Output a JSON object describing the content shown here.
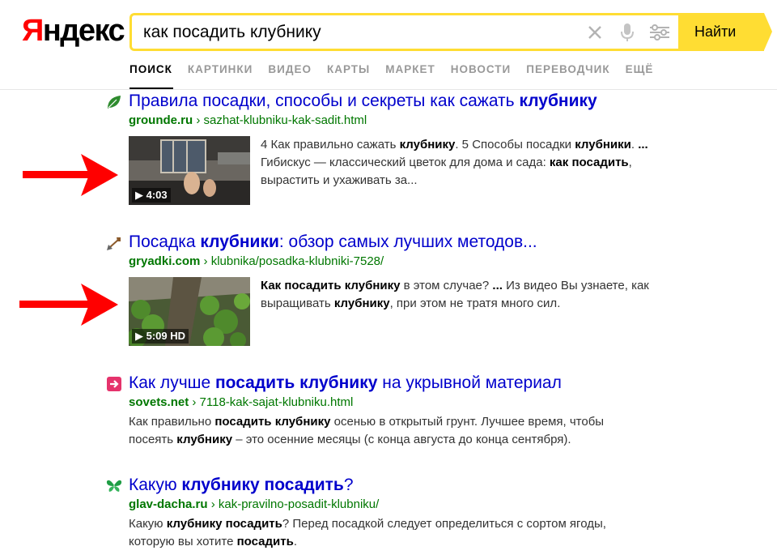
{
  "logo": {
    "first": "Я",
    "rest": "ндекс"
  },
  "search": {
    "query": "как посадить клубнику",
    "button": "Найти"
  },
  "tabs": [
    "ПОИСК",
    "КАРТИНКИ",
    "ВИДЕО",
    "КАРТЫ",
    "МАРКЕТ",
    "НОВОСТИ",
    "ПЕРЕВОДЧИК",
    "ЕЩЁ"
  ],
  "results": [
    {
      "title_parts": [
        {
          "t": "Правила посадки, способы и секреты как сажать ",
          "b": false
        },
        {
          "t": "клубнику",
          "b": true
        }
      ],
      "host": "grounde.ru",
      "path": "sazhat-klubniku-kak-sadit.html",
      "video_duration": "▶ 4:03",
      "snippet_parts": [
        {
          "t": "4 Как правильно сажать ",
          "b": false
        },
        {
          "t": "клубнику",
          "b": true
        },
        {
          "t": ". 5 Способы посадки ",
          "b": false
        },
        {
          "t": "клубники",
          "b": true
        },
        {
          "t": ". ",
          "b": false
        },
        {
          "t": "...",
          "b": true
        },
        {
          "t": " Гибискус — классический цветок для дома и сада: ",
          "b": false
        },
        {
          "t": "как посадить",
          "b": true
        },
        {
          "t": ", вырастить и ухаживать за...",
          "b": false
        }
      ]
    },
    {
      "title_parts": [
        {
          "t": "Посадка ",
          "b": false
        },
        {
          "t": "клубники",
          "b": true
        },
        {
          "t": ": обзор самых лучших методов...",
          "b": false
        }
      ],
      "host": "gryadki.com",
      "path": "klubnika/posadka-klubniki-7528/",
      "video_duration": "▶ 5:09 HD",
      "snippet_parts": [
        {
          "t": "Как посадить клубнику",
          "b": true
        },
        {
          "t": " в этом случае? ",
          "b": false
        },
        {
          "t": "...",
          "b": true
        },
        {
          "t": " Из видео Вы узнаете, как выращивать ",
          "b": false
        },
        {
          "t": "клубнику",
          "b": true
        },
        {
          "t": ", при этом не тратя много сил.",
          "b": false
        }
      ]
    },
    {
      "title_parts": [
        {
          "t": "Как лучше ",
          "b": false
        },
        {
          "t": "посадить клубнику",
          "b": true
        },
        {
          "t": " на укрывной материал",
          "b": false
        }
      ],
      "host": "sovets.net",
      "path": "7118-kak-sajat-klubniku.html",
      "snippet_parts": [
        {
          "t": "Как правильно ",
          "b": false
        },
        {
          "t": "посадить клубнику",
          "b": true
        },
        {
          "t": " осенью в открытый грунт. Лучшее время, чтобы посеять ",
          "b": false
        },
        {
          "t": "клубнику",
          "b": true
        },
        {
          "t": " – это осенние месяцы (с конца августа до конца сентября).",
          "b": false
        }
      ]
    },
    {
      "title_parts": [
        {
          "t": "Какую ",
          "b": false
        },
        {
          "t": "клубнику посадить",
          "b": true
        },
        {
          "t": "?",
          "b": false
        }
      ],
      "host": "glav-dacha.ru",
      "path": "kak-pravilno-posadit-klubniku/",
      "snippet_parts": [
        {
          "t": "Какую ",
          "b": false
        },
        {
          "t": "клубнику посадить",
          "b": true
        },
        {
          "t": "? Перед посадкой следует определиться с сортом ягоды, которую вы хотите ",
          "b": false
        },
        {
          "t": "посадить",
          "b": true
        },
        {
          "t": ".",
          "b": false
        }
      ]
    }
  ],
  "colors": {
    "accent": "#ffdd33",
    "link": "#0000cc",
    "url": "#007700",
    "arrow": "#ff0000"
  }
}
